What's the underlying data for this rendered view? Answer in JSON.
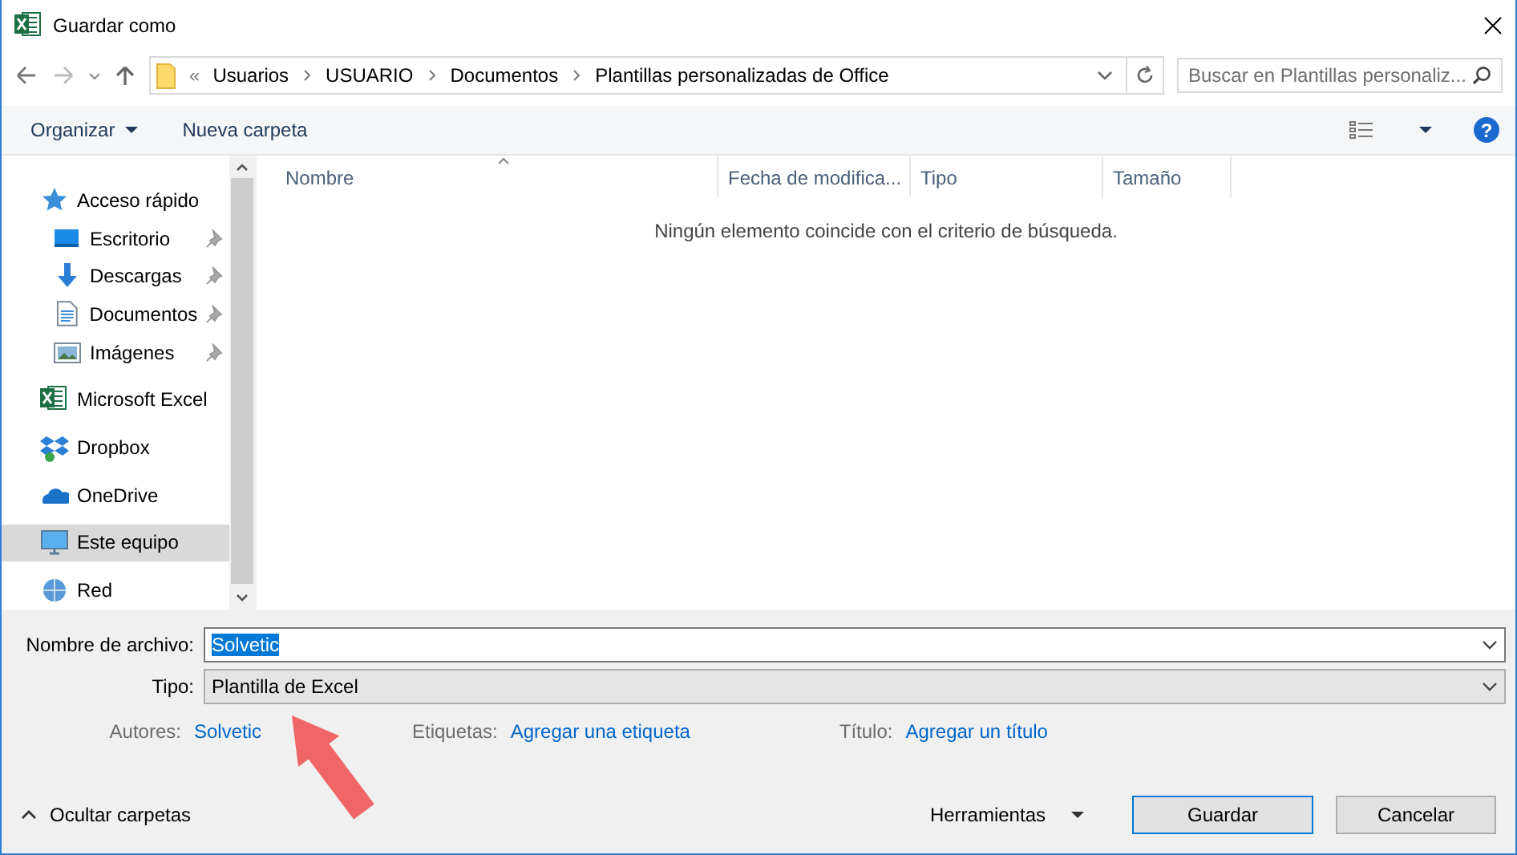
{
  "window": {
    "title": "Guardar como"
  },
  "address_bar": {
    "overflow": "«",
    "crumbs": [
      "Usuarios",
      "USUARIO",
      "Documentos",
      "Plantillas personalizadas de Office"
    ]
  },
  "search": {
    "placeholder": "Buscar en Plantillas personaliz..."
  },
  "toolbar": {
    "organize": "Organizar",
    "new_folder": "Nueva carpeta",
    "help": "?"
  },
  "nav": {
    "items": [
      {
        "label": "Acceso rápido",
        "selected": false,
        "children": [
          {
            "label": "Escritorio",
            "pinned": true,
            "selected": false
          },
          {
            "label": "Descargas",
            "pinned": true,
            "selected": false
          },
          {
            "label": "Documentos",
            "pinned": true,
            "selected": false
          },
          {
            "label": "Imágenes",
            "pinned": true,
            "selected": false
          }
        ]
      },
      {
        "label": "Microsoft Excel",
        "selected": false
      },
      {
        "label": "Dropbox",
        "selected": false
      },
      {
        "label": "OneDrive",
        "selected": false
      },
      {
        "label": "Este equipo",
        "selected": true
      },
      {
        "label": "Red",
        "selected": false
      }
    ]
  },
  "file_list": {
    "columns": [
      {
        "label": "Nombre",
        "sorted": true
      },
      {
        "label": "Fecha de modifica...",
        "sorted": false
      },
      {
        "label": "Tipo",
        "sorted": false
      },
      {
        "label": "Tamaño",
        "sorted": false
      }
    ],
    "empty_message": "Ningún elemento coincide con el criterio de búsqueda."
  },
  "form": {
    "file_name": {
      "label": "Nombre de archivo:",
      "value": "Solvetic",
      "selected": true
    },
    "type": {
      "label": "Tipo:",
      "value": "Plantilla de Excel"
    },
    "authors": {
      "label": "Autores:",
      "value": "Solvetic"
    },
    "tags": {
      "label": "Etiquetas:",
      "value": "Agregar una etiqueta"
    },
    "title": {
      "label": "Título:",
      "value": "Agregar un título"
    }
  },
  "footer": {
    "hide_folders": "Ocultar carpetas",
    "tools": "Herramientas",
    "save": "Guardar",
    "cancel": "Cancelar"
  }
}
